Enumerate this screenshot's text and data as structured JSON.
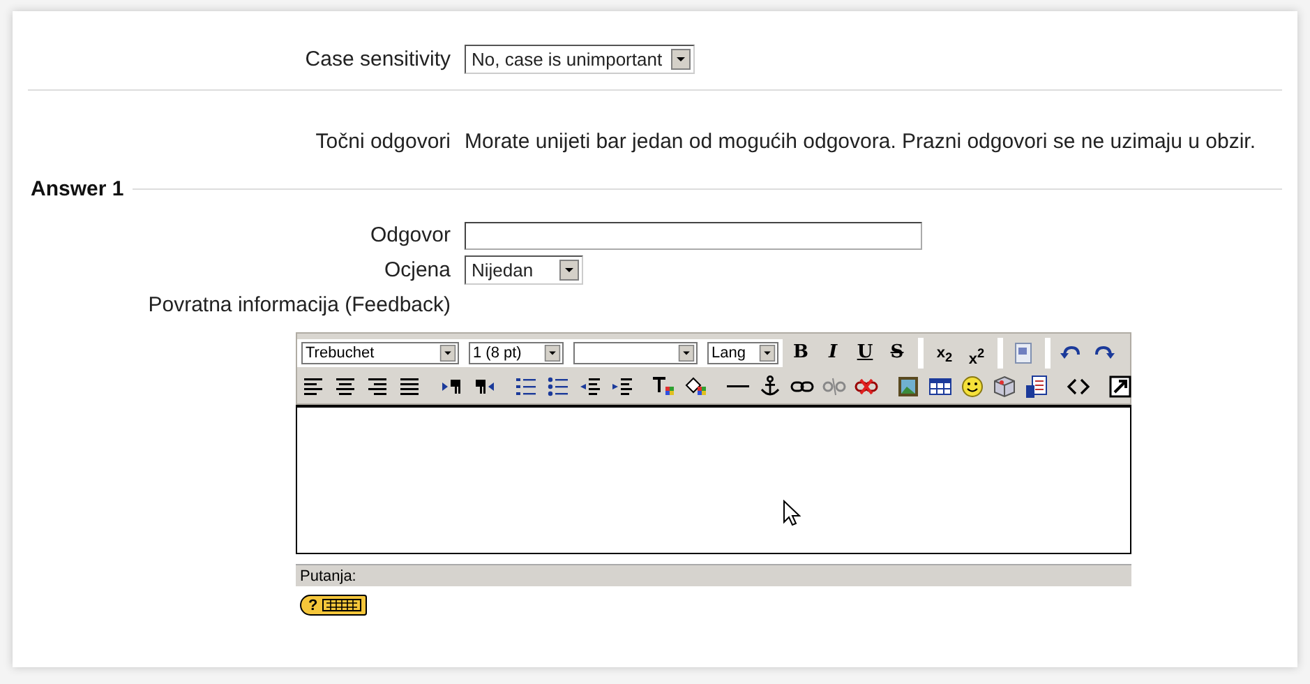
{
  "case_sensitivity": {
    "label": "Case sensitivity",
    "value": "No, case is unimportant"
  },
  "correct_answers": {
    "label": "Točni odgovori",
    "note": "Morate unijeti bar jedan od mogućih odgovora. Prazni odgovori se ne uzimaju u obzir."
  },
  "answer": {
    "legend": "Answer 1",
    "answer_label": "Odgovor",
    "grade_label": "Ocjena",
    "grade_value": "Nijedan",
    "feedback_label": "Povratna informacija (Feedback)"
  },
  "editor": {
    "selects": [
      {
        "kind": "font",
        "value": "Trebuchet"
      },
      {
        "kind": "size",
        "value": "1 (8 pt)"
      },
      {
        "kind": "blank"
      },
      {
        "kind": "lang",
        "value": "Lang"
      }
    ],
    "format_buttons": [
      {
        "kind": "bold",
        "label": "B"
      },
      {
        "kind": "italic",
        "label": "I"
      },
      {
        "kind": "underline",
        "label": "U"
      },
      {
        "kind": "strike",
        "label": "S"
      }
    ],
    "script_buttons": [
      {
        "label": "x$_{2}$"
      },
      {
        "label": "x$^{2}$"
      }
    ],
    "path_label": "Putanja:",
    "help": {
      "label": "?"
    }
  }
}
